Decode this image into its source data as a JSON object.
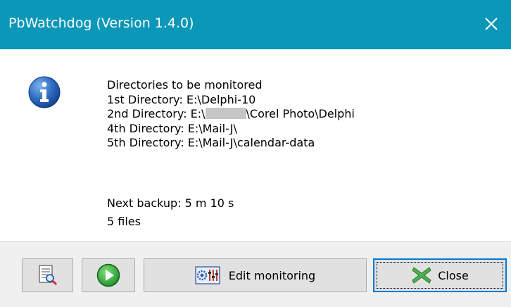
{
  "window": {
    "title": "PbWatchdog (Version 1.4.0)",
    "close_glyph": "✕",
    "titlebar_color": "#0b97b8"
  },
  "message": {
    "icon": "info-icon",
    "heading": "Directories to be monitored",
    "dir1": "1st Directory: E:\\Delphi-10",
    "dir2_prefix": "2nd Directory: E:\\",
    "dir2_suffix": "\\Corel Photo\\Delphi",
    "dir4": "4th Directory: E:\\Mail-J\\",
    "dir5": "5th Directory: E:\\Mail-J\\calendar-data"
  },
  "status": {
    "next_backup": "Next backup: 5 m 10 s",
    "files": "5 files"
  },
  "buttons": {
    "view_icon": "view-log-icon",
    "start_icon": "play-icon",
    "edit_icon": "settings-icon",
    "edit_label": "Edit monitoring",
    "close_icon": "red-x-icon",
    "close_label": "Close"
  }
}
